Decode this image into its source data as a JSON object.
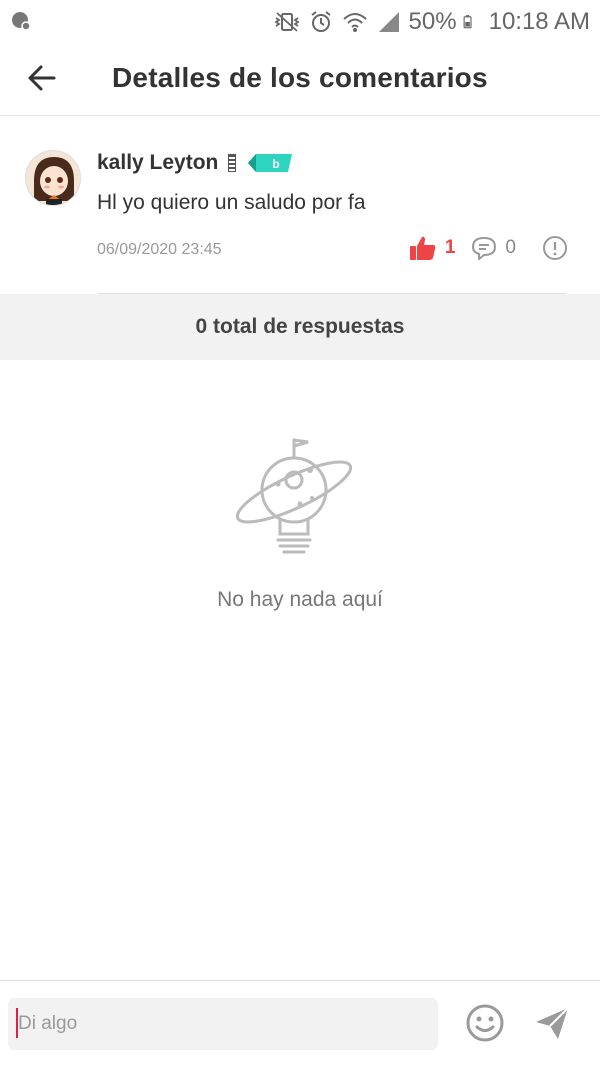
{
  "status_bar": {
    "battery": "50%",
    "time": "10:18 AM"
  },
  "header": {
    "title": "Detalles de los comentarios"
  },
  "comment": {
    "username": "kally Leyton",
    "badge_letter": "b",
    "text": "Hl yo quiero un saludo por fa",
    "timestamp": "06/09/2020 23:45",
    "likes": "1",
    "replies": "0"
  },
  "replies_summary": {
    "total_label": "0 total de respuestas"
  },
  "empty_state": {
    "message": "No hay nada aquí"
  },
  "composer": {
    "placeholder": "Di algo"
  },
  "colors": {
    "like_red": "#ef4444",
    "badge_teal": "#2dd4bf",
    "caret_pink": "#e11d48"
  }
}
